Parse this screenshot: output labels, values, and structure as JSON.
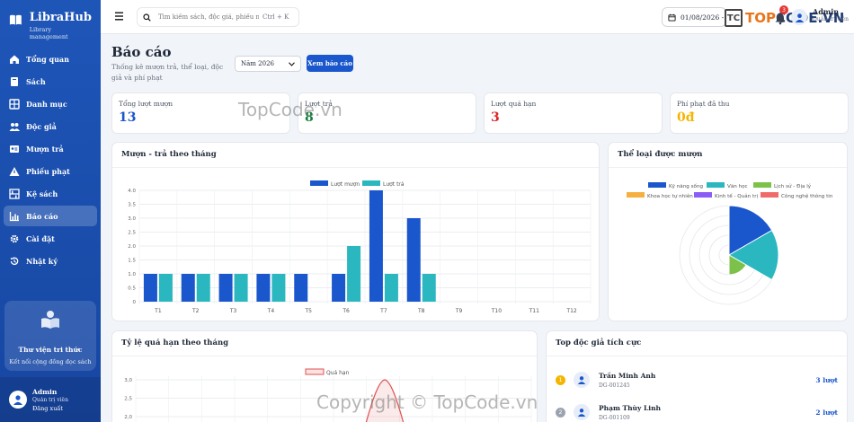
{
  "sidebar": {
    "brand": "LibraHub",
    "brand_sub": "Library management",
    "items": [
      {
        "label": "Tổng quan",
        "icon": "home-icon"
      },
      {
        "label": "Sách",
        "icon": "book-icon"
      },
      {
        "label": "Danh mục",
        "icon": "grid-icon"
      },
      {
        "label": "Độc giả",
        "icon": "users-icon"
      },
      {
        "label": "Mượn trả",
        "icon": "id-card-icon"
      },
      {
        "label": "Phiếu phạt",
        "icon": "warning-icon"
      },
      {
        "label": "Kệ sách",
        "icon": "shelf-icon"
      },
      {
        "label": "Báo cáo",
        "icon": "chart-icon",
        "active": true
      },
      {
        "label": "Cài đặt",
        "icon": "gear-icon"
      },
      {
        "label": "Nhật ký",
        "icon": "history-icon"
      }
    ],
    "promo": {
      "title": "Thư viện tri thức",
      "subtitle": "Kết nối cộng đồng đọc sách"
    },
    "user": {
      "name": "Admin",
      "role": "Quản trị viên",
      "logout": "Đăng xuất"
    }
  },
  "topbar": {
    "search_placeholder": "Tìm kiếm sách, độc giả, phiếu mượn...",
    "shortcut": "Ctrl + K",
    "date": "01/08/2026 - 31/08/2026",
    "notifications": "3",
    "user_name": "Admin",
    "user_role": "Quản trị viên",
    "logo_text_a": "TOP",
    "logo_text_b": "CODE.VN"
  },
  "page": {
    "title": "Báo cáo",
    "description": "Thống kê mượn trả, thể loại, độc giả và phí phạt",
    "year": "Năm 2026",
    "view_button": "Xem báo cáo"
  },
  "stats": [
    {
      "label": "Tổng lượt mượn",
      "value": "13",
      "color": "#1a56cc"
    },
    {
      "label": "Lượt trả",
      "value": "8",
      "color": "#15803d"
    },
    {
      "label": "Lượt quá hạn",
      "value": "3",
      "color": "#dc2626"
    },
    {
      "label": "Phí phạt đã thu",
      "value": "0đ",
      "color": "#f5b400"
    }
  ],
  "cards": {
    "borrow_title": "Mượn - trả theo tháng",
    "genre_title": "Thể loại được mượn",
    "overdue_title": "Tỷ lệ quá hạn theo tháng",
    "readers_title": "Top độc giả tích cực"
  },
  "chart_data": [
    {
      "type": "bar",
      "categories": [
        "T1",
        "T2",
        "T3",
        "T4",
        "T5",
        "T6",
        "T7",
        "T8",
        "T9",
        "T10",
        "T11",
        "T12"
      ],
      "series": [
        {
          "name": "Lượt mượn",
          "values": [
            1,
            1,
            1,
            1,
            1,
            1,
            4,
            3,
            0,
            0,
            0,
            0
          ],
          "color": "#1a56cc"
        },
        {
          "name": "Lượt trả",
          "values": [
            1,
            1,
            1,
            1,
            0,
            2,
            1,
            1,
            0,
            0,
            0,
            0
          ],
          "color": "#2ab7c0"
        }
      ],
      "ylim": [
        0,
        4
      ],
      "yticks": [
        "0",
        "0.5",
        "1.0",
        "1.5",
        "2.0",
        "2.5",
        "3.0",
        "3.5",
        "4.0"
      ],
      "grid": true,
      "legend": "top"
    },
    {
      "type": "polarArea",
      "categories": [
        "Kỹ năng sống",
        "Văn học",
        "Lịch sử - Địa lý",
        "Khoa học tự nhiên",
        "Kinh tế - Quản trị",
        "Công nghệ thông tin"
      ],
      "values": [
        5,
        5,
        2,
        0,
        0,
        0
      ],
      "colors": [
        "#1a56cc",
        "#2ab7c0",
        "#7cc24a",
        "#f5b040",
        "#8b5cf6",
        "#ef6b6b"
      ],
      "legend": "top"
    },
    {
      "type": "line",
      "series": [
        {
          "name": "Quá hạn",
          "color": "#e05252"
        }
      ],
      "visible_yticks": [
        "3,0",
        "2,5",
        "2,0"
      ],
      "legend": "top"
    }
  ],
  "readers": [
    {
      "rank": "1",
      "name": "Trần Minh Anh",
      "code": "DG-001245",
      "count": "3 lượt",
      "rank_color": "#f5b400"
    },
    {
      "rank": "2",
      "name": "Phạm Thùy Linh",
      "code": "DG-001109",
      "count": "2 lượt",
      "rank_color": "#9ca3af"
    }
  ],
  "watermarks": [
    "TopCode.vn",
    "Copyright © TopCode.vn"
  ]
}
